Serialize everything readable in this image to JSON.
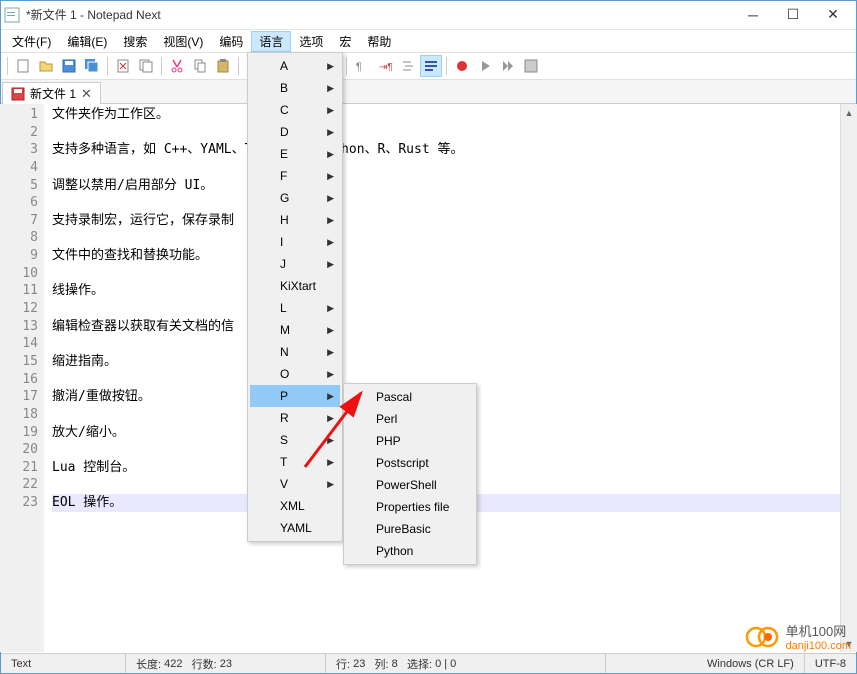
{
  "title": "*新文件 1 - Notepad Next",
  "menubar": [
    "文件(F)",
    "编辑(E)",
    "搜索",
    "视图(V)",
    "编码",
    "语言",
    "选项",
    "宏",
    "帮助"
  ],
  "active_menu_index": 5,
  "tab": {
    "label": "新文件 1"
  },
  "lines": [
    "文件夹作为工作区。",
    "",
    "支持多种语言，如 C++、YAML、TeX、PHP、Python、R、Rust 等。",
    "",
    "调整以禁用/启用部分 UI。",
    "",
    "支持录制宏，运行它，保存录制",
    "",
    "文件中的查找和替换功能。",
    "",
    "线操作。",
    "",
    "编辑检查器以获取有关文档的信",
    "",
    "缩进指南。",
    "",
    "撤消/重做按钮。",
    "",
    "放大/缩小。",
    "",
    "Lua 控制台。",
    "",
    "EOL 操作。"
  ],
  "highlight_line": 23,
  "lang_menu": [
    {
      "label": "A",
      "sub": true
    },
    {
      "label": "B",
      "sub": true
    },
    {
      "label": "C",
      "sub": true
    },
    {
      "label": "D",
      "sub": true
    },
    {
      "label": "E",
      "sub": true
    },
    {
      "label": "F",
      "sub": true
    },
    {
      "label": "G",
      "sub": true
    },
    {
      "label": "H",
      "sub": true
    },
    {
      "label": "I",
      "sub": true
    },
    {
      "label": "J",
      "sub": true
    },
    {
      "label": "KiXtart",
      "sub": false
    },
    {
      "label": "L",
      "sub": true
    },
    {
      "label": "M",
      "sub": true
    },
    {
      "label": "N",
      "sub": true
    },
    {
      "label": "O",
      "sub": true
    },
    {
      "label": "P",
      "sub": true,
      "hl": true
    },
    {
      "label": "R",
      "sub": true
    },
    {
      "label": "S",
      "sub": true
    },
    {
      "label": "T",
      "sub": true
    },
    {
      "label": "V",
      "sub": true
    },
    {
      "label": "XML",
      "sub": false
    },
    {
      "label": "YAML",
      "sub": false
    }
  ],
  "p_submenu": [
    "Pascal",
    "Perl",
    "PHP",
    "Postscript",
    "PowerShell",
    "Properties file",
    "PureBasic",
    "Python"
  ],
  "status": {
    "mode": "Text",
    "len_label": "长度:",
    "len": "422",
    "lines_label": "行数:",
    "lines": "23",
    "ln_label": "行:",
    "ln": "23",
    "col_label": "列:",
    "col": "8",
    "sel_label": "选择:",
    "sel": "0 | 0",
    "eol": "Windows (CR LF)",
    "enc": "UTF-8"
  },
  "watermark": {
    "line1": "单机100网",
    "line2": "danji100.com"
  }
}
